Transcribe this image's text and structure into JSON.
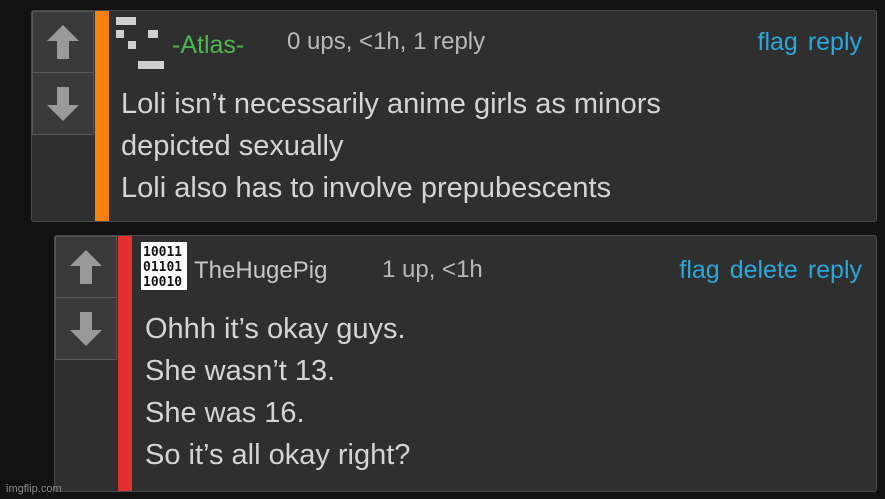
{
  "colors": {
    "page_bg": "#121212",
    "card_bg": "#2f2f2f",
    "link_blue": "#29a8dc",
    "atlas_green": "#4cb84c",
    "bar_orange": "#f7830f",
    "bar_red": "#e23030"
  },
  "comments": [
    {
      "username": "-Atlas-",
      "meta": "0 ups, <1h, 1 reply",
      "actions": [
        "flag",
        "reply"
      ],
      "bar_color": "#f7830f",
      "avatar_icon": "pixel-avatar-icon",
      "body": [
        "Loli isn’t necessarily anime girls as minors",
        "depicted sexually",
        "Loli also has to involve prepubescents"
      ]
    },
    {
      "username": "TheHugePig",
      "meta": "1 up, <1h",
      "actions": [
        "flag",
        "delete",
        "reply"
      ],
      "bar_color": "#e23030",
      "avatar_icon": "binary-avatar-icon",
      "avatar_text": [
        "10011",
        "01101",
        "10010"
      ],
      "body": [
        "Ohhh it’s okay guys.",
        "She wasn’t 13.",
        "She was 16.",
        "So it’s all okay right?"
      ]
    }
  ],
  "vote_icons": [
    "upvote-arrow-icon",
    "downvote-arrow-icon"
  ],
  "watermark": "imgflip.com"
}
